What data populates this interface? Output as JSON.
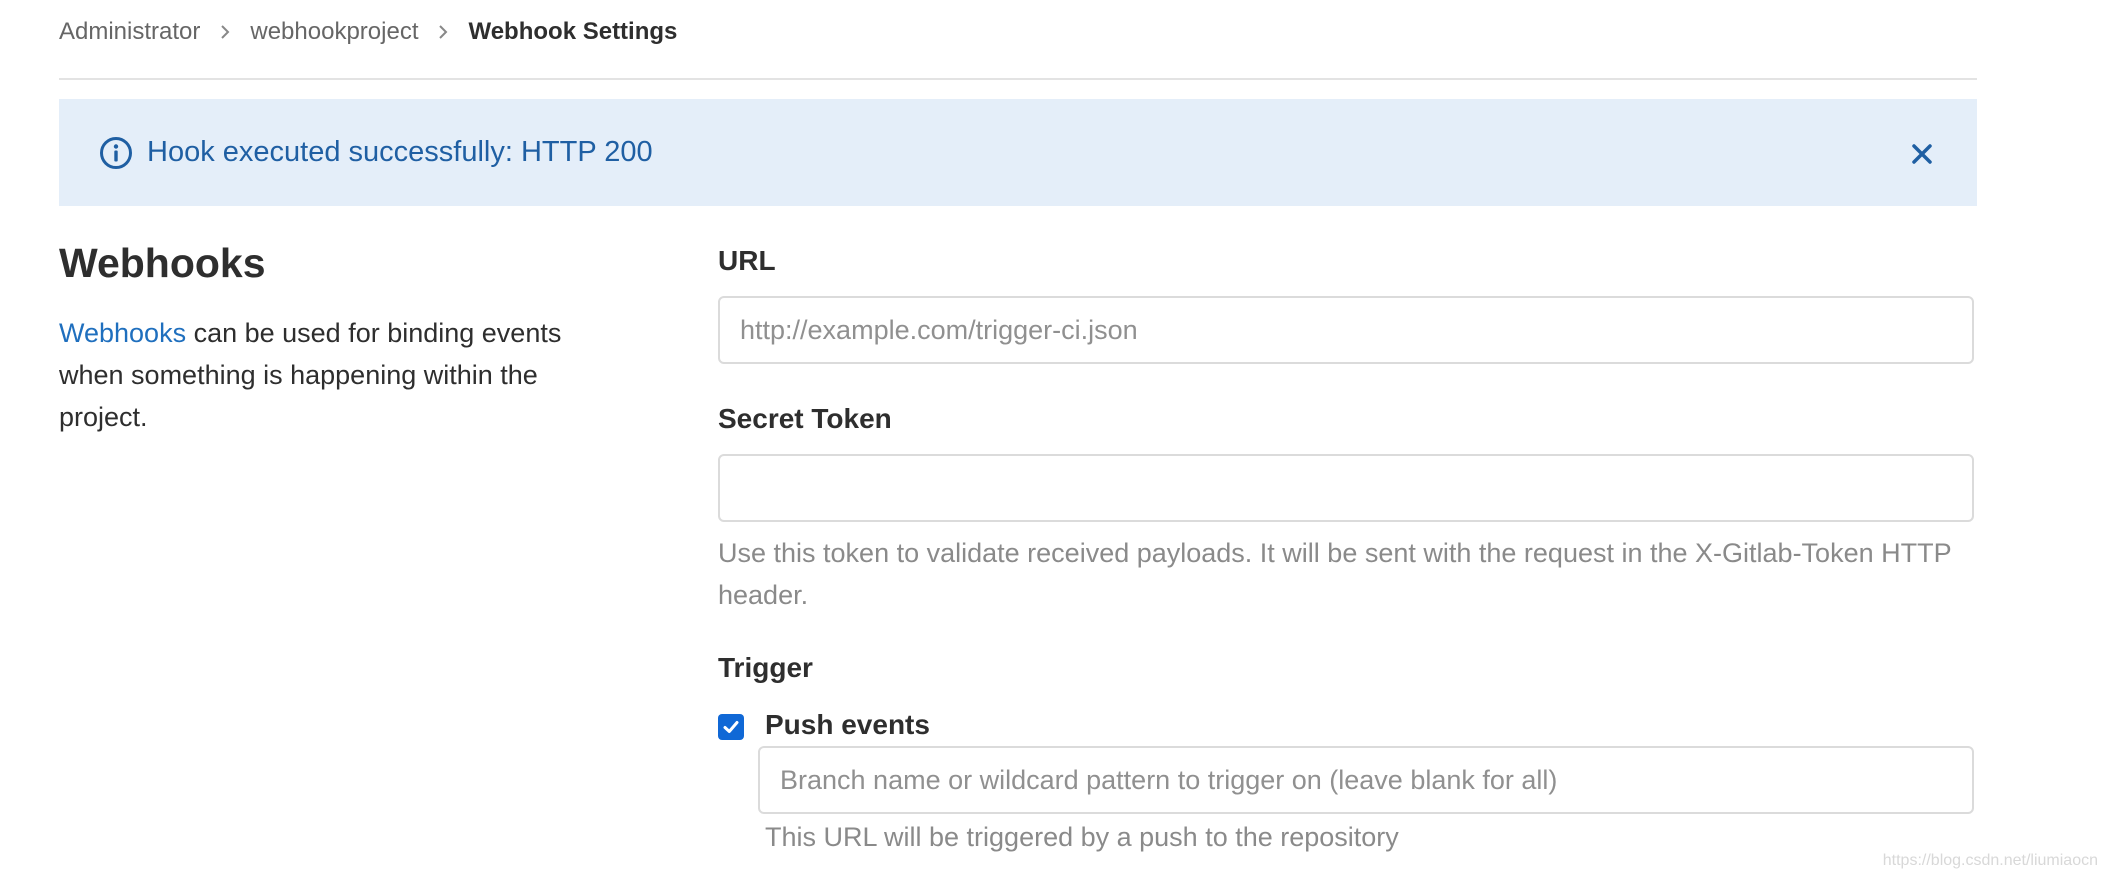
{
  "breadcrumb": {
    "items": [
      "Administrator",
      "webhookproject"
    ],
    "current": "Webhook Settings"
  },
  "alert": {
    "message": "Hook executed successfully: HTTP 200",
    "icon": "info-circle-icon",
    "close_icon": "close-icon",
    "color": "#1f5fa3",
    "background": "#e4eef9"
  },
  "section": {
    "title": "Webhooks",
    "link_text": "Webhooks",
    "description_rest": " can be used for binding events when something is happening within the project."
  },
  "form": {
    "url": {
      "label": "URL",
      "value": "",
      "placeholder": "http://example.com/trigger-ci.json"
    },
    "secret_token": {
      "label": "Secret Token",
      "value": "",
      "placeholder": "",
      "help": "Use this token to validate received payloads. It will be sent with the request in the X-Gitlab-Token HTTP header."
    },
    "trigger": {
      "label": "Trigger",
      "push_events": {
        "label": "Push events",
        "checked": true,
        "branch_filter_placeholder": "Branch name or wildcard pattern to trigger on (leave blank for all)",
        "help": "This URL will be triggered by a push to the repository"
      }
    }
  },
  "watermark": "https://blog.csdn.net/liumiaocn"
}
